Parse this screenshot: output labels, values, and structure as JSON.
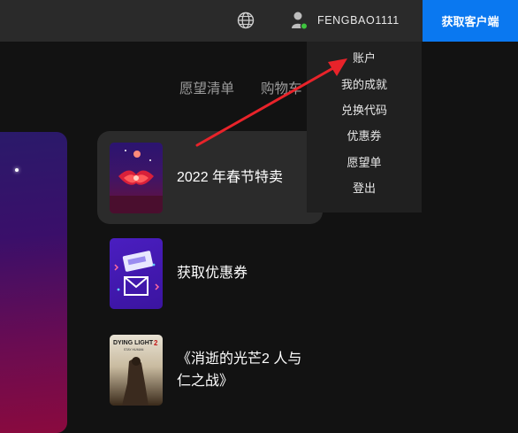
{
  "header": {
    "username": "FENGBAO1111",
    "get_client_label": "获取客户端"
  },
  "subnav": {
    "items": [
      "愿望清单",
      "购物车"
    ]
  },
  "promos": [
    {
      "label": "2022 年春节特卖"
    },
    {
      "label": "获取优惠券"
    },
    {
      "label": "《消逝的光芒2 人与",
      "label2": "仁之战》"
    }
  ],
  "thumb3_text": {
    "line1": "DYING LIGHT",
    "num": "2",
    "line2": "STAY HUMAN"
  },
  "account_menu": {
    "items": [
      "账户",
      "我的成就",
      "兑换代码",
      "优惠券",
      "愿望单",
      "登出"
    ]
  },
  "colors": {
    "accent": "#0a78f0",
    "annotation_arrow": "#e8232a",
    "online_dot": "#3ec43e"
  }
}
